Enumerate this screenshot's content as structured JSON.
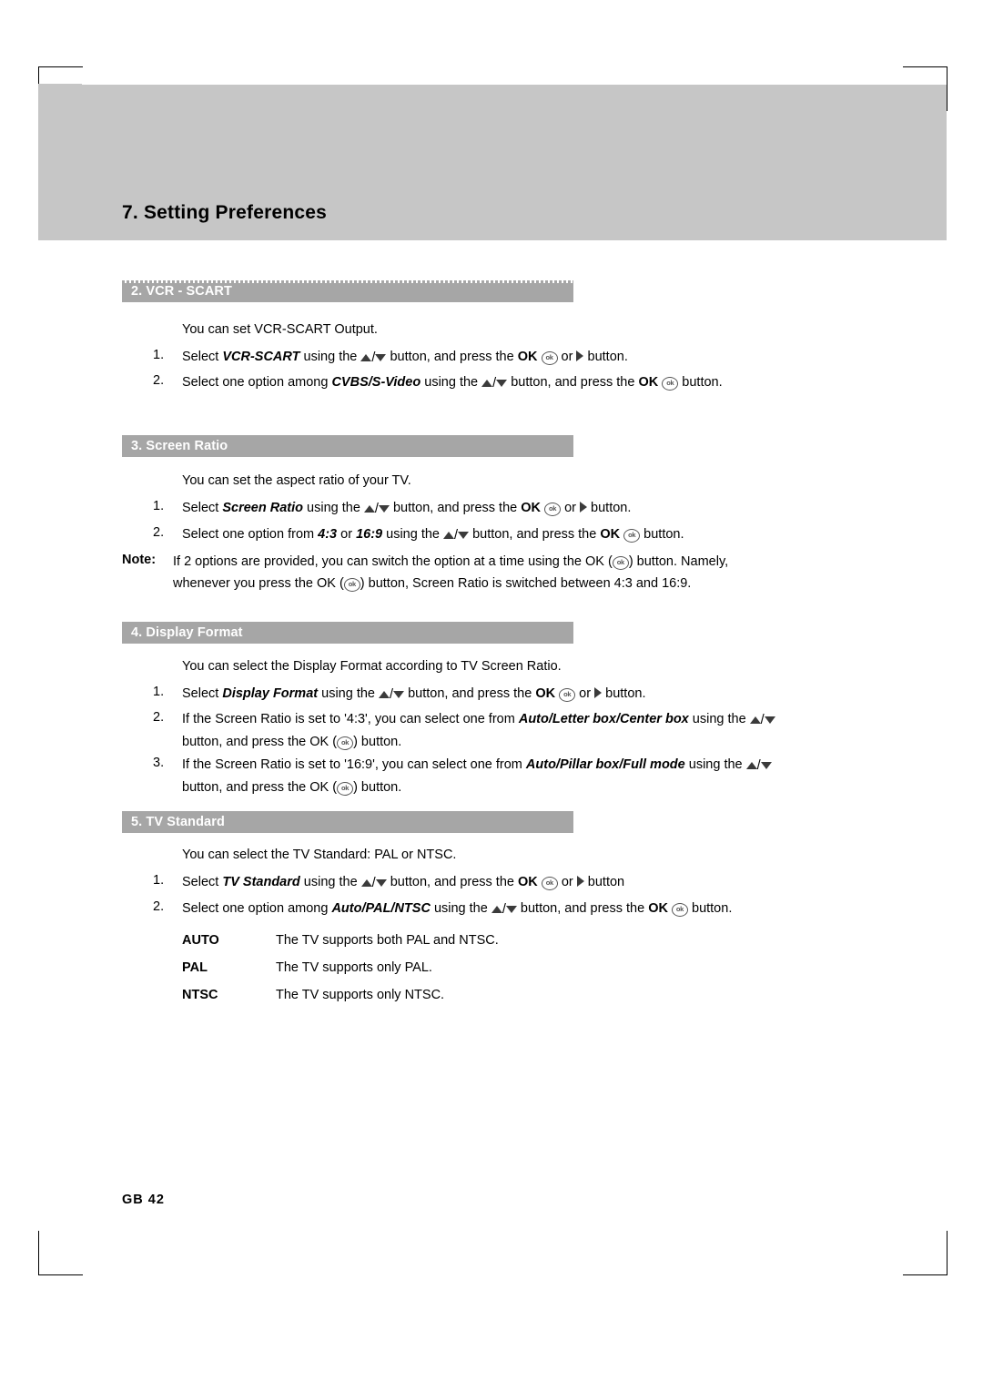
{
  "page": {
    "chapter_title": "7. Setting Preferences",
    "footer": "GB 42"
  },
  "sections": [
    {
      "bar": "2. VCR - SCART",
      "intro": "You can set VCR-SCART Output.",
      "steps": [
        {
          "num": "1.",
          "parts": [
            "Select ",
            "VCR-SCART",
            " using the ",
            "UPDOWN",
            " button, and press the ",
            "OK",
            "OKICON",
            " or ",
            "RIGHT",
            " button."
          ]
        },
        {
          "num": "2.",
          "parts": [
            "Select one option among ",
            "CVBS/S-Video",
            " using the ",
            "UPDOWN",
            " button, and press the ",
            "OK",
            "OKICON",
            " button."
          ]
        }
      ]
    },
    {
      "bar": "3. Screen Ratio",
      "intro": "You can set the aspect ratio of your TV.",
      "steps": [
        {
          "num": "1.",
          "parts": [
            "Select ",
            "Screen Ratio",
            " using the ",
            "UPDOWN",
            " button, and press the ",
            "OK",
            "OKICON",
            " or ",
            "RIGHT",
            " button."
          ]
        },
        {
          "num": "2.",
          "parts": [
            "Select one option from ",
            "4:3",
            " or ",
            "16:9",
            " using the ",
            "UPDOWN",
            " button, and press the ",
            "OK",
            "OKICON",
            " button."
          ]
        }
      ],
      "note": {
        "label": "Note:",
        "line1": "If 2 options are provided, you can switch the option at a time using the OK ( ) button. Namely,",
        "line2": "whenever you press the OK ( ) button, Screen Ratio is switched between 4:3 and 16:9."
      }
    },
    {
      "bar": "4. Display Format",
      "intro": "You can select the Display Format according to TV Screen Ratio.",
      "steps": [
        {
          "num": "1.",
          "parts": [
            "Select ",
            "Display Format",
            " using the ",
            "UPDOWN",
            " button, and press the ",
            "OK",
            "OKICON",
            " or ",
            "RIGHT",
            " button."
          ]
        },
        {
          "num": "2.",
          "line1": "If the Screen Ratio is set to '4:3', you can select one from Auto/Letter box/Center box using the",
          "line2": "button, and press the OK ( ) button."
        },
        {
          "num": "3.",
          "line1": "If the Screen Ratio is set to '16:9', you can select one from Auto/Pillar box/Full mode using the",
          "line2": "button, and press the OK ( ) button."
        }
      ]
    },
    {
      "bar": "5. TV Standard",
      "intro": "You can select the TV Standard: PAL or NTSC.",
      "steps": [
        {
          "num": "1.",
          "parts": [
            "Select ",
            "TV Standard",
            " using the ",
            "UPDOWN",
            " button, and press the ",
            "OK",
            "OKICON",
            " or ",
            "RIGHT",
            " button"
          ]
        },
        {
          "num": "2.",
          "parts": [
            "Select one option among ",
            "Auto/PAL/NTSC",
            " using the ",
            "UPDOWN",
            " button, and press the ",
            "OK",
            "OKICON",
            " button."
          ]
        }
      ],
      "table": [
        {
          "key": "AUTO",
          "value": "The TV supports both PAL and NTSC."
        },
        {
          "key": "PAL",
          "value": "The TV supports only PAL."
        },
        {
          "key": "NTSC",
          "value": "The TV supports only NTSC."
        }
      ]
    }
  ],
  "labels": {
    "ok": "OK",
    "ok_icon": "ok",
    "vcr_scart_term": "VCR-SCART",
    "cvbs_term": "CVBS/S-Video",
    "screen_ratio_term": "Screen Ratio",
    "ratio_43": "4:3",
    "ratio_169": "16:9",
    "display_format_term": "Display Format",
    "format_43_options": "Auto/Letter box/Center box",
    "format_169_options": "Auto/Pillar box/Full mode",
    "tv_standard_term": "TV Standard",
    "tv_standard_options": "Auto/PAL/NTSC",
    "select": "Select",
    "using_the": "using the",
    "button_and_press_the": "button, and press the",
    "button": "button.",
    "button_no_dot": "button",
    "or": "or",
    "select_one_option_among": "Select one option among",
    "select_one_option_from": "Select one option from",
    "note_word": "Note:",
    "screen_ratio_43_prefix": "If the Screen Ratio is set to '4:3', you can select one from",
    "screen_ratio_169_prefix": "If the Screen Ratio is set to '16:9', you can select one from",
    "button_and_press_ok_button": "button, and press the OK (",
    "close_button": ") button.",
    "note_line1_a": "If 2 options are provided, you can switch the option at a time using the OK (",
    "note_line1_b": ") button. Namely,",
    "note_line2_a": "whenever you press the OK (",
    "note_line2_b": ") button, Screen Ratio is switched between 4:3 and 16:9."
  }
}
